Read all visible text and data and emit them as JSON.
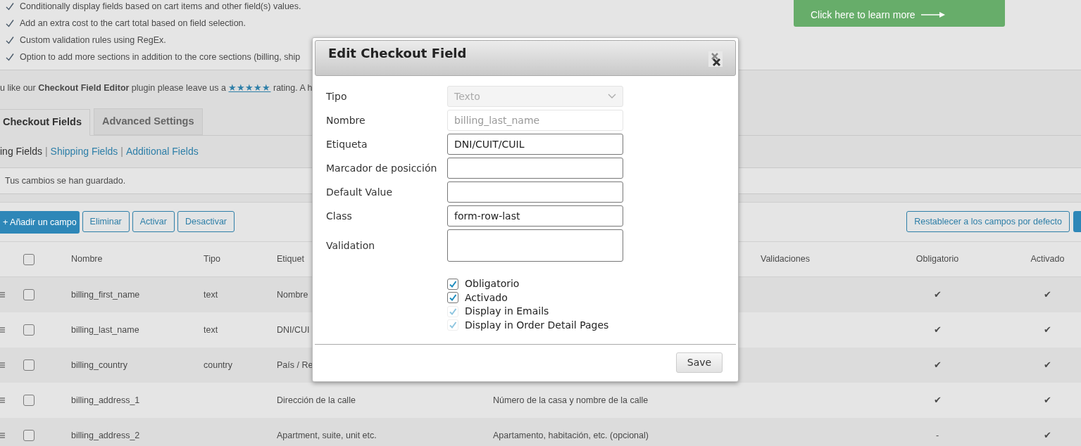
{
  "features": [
    "Conditionally display fields based on cart items and other field(s) values.",
    "Add an extra cost to the cart total based on field selection.",
    "Custom validation rules using RegEx.",
    "Option to add more sections in addition to the core sections (billing, ship"
  ],
  "upgrade_banner": {
    "subtitle": "Click here to learn more"
  },
  "rating_notice": {
    "before": "u like our **Checkout Field Editor** plugin please leave us a",
    "stars_link": "★★★★★",
    "after": "rating. A h"
  },
  "tabs": [
    {
      "label": "Checkout Fields",
      "selected": true
    },
    {
      "label": "Advanced Settings",
      "selected": false
    }
  ],
  "sections": [
    {
      "label": "ing Fields",
      "selected": true
    },
    {
      "separator": "|",
      "label": "Shipping Fields",
      "selected": false
    },
    {
      "separator": "|",
      "label": "Additional Fields",
      "selected": false
    }
  ],
  "notice": "Tus cambios se han guardado.",
  "toolbar": {
    "add": "+ Añadir un campo",
    "buttons": [
      "Eliminar",
      "Activar",
      "Desactivar"
    ],
    "reset": "Restablecer a los campos por defecto"
  },
  "table": {
    "select_all_checked": false,
    "columns": [
      "Nombre",
      "Tipo",
      "Etiquet",
      "Validaciones",
      "Obligatorio",
      "Activado"
    ],
    "rows": [
      {
        "checked": false,
        "name": "billing_first_name",
        "type": "text",
        "label": "Nombre",
        "placeholder": "",
        "required": "✔",
        "enabled": "✔"
      },
      {
        "checked": false,
        "name": "billing_last_name",
        "type": "text",
        "label": "DNI/CUI",
        "placeholder": "",
        "required": "✔",
        "enabled": "✔"
      },
      {
        "checked": false,
        "name": "billing_country",
        "type": "country",
        "label": "País / Re",
        "placeholder": "",
        "required": "✔",
        "enabled": "✔"
      },
      {
        "checked": false,
        "name": "billing_address_1",
        "type": "",
        "label": "Dirección de la calle",
        "placeholder": "Número de la casa y nombre de la calle",
        "required": "✔",
        "enabled": "✔"
      },
      {
        "checked": false,
        "name": "billing_address_2",
        "type": "",
        "label": "Apartment, suite, unit etc.",
        "placeholder": "Apartamento, habitación, etc. (opcional)",
        "required": "-",
        "enabled": "✔"
      }
    ]
  },
  "dialog": {
    "title": "Edit Checkout Field",
    "fields": [
      {
        "label": "Tipo",
        "kind": "select",
        "value": "Texto",
        "disabled": true
      },
      {
        "label": "Nombre",
        "kind": "text",
        "value": "billing_last_name",
        "disabled": true
      },
      {
        "label": "Etiqueta",
        "kind": "text",
        "value": "DNI/CUIT/CUIL",
        "disabled": false
      },
      {
        "label": "Marcador de posicción",
        "kind": "text",
        "disabled": false
      },
      {
        "label": "Default Value",
        "kind": "text",
        "disabled": false
      },
      {
        "label": "Class",
        "kind": "text",
        "value": "form-row-last",
        "disabled": false
      },
      {
        "label": "Validation",
        "kind": "multiselect",
        "disabled": false
      }
    ],
    "options": [
      {
        "label": "Obligatorio",
        "checked": true,
        "disabled": false
      },
      {
        "label": "Activado",
        "checked": true,
        "disabled": false
      },
      {
        "label": "Display in Emails",
        "checked": true,
        "disabled": true
      },
      {
        "label": "Display in Order Detail Pages",
        "checked": true,
        "disabled": true
      }
    ],
    "save": "Save"
  }
}
